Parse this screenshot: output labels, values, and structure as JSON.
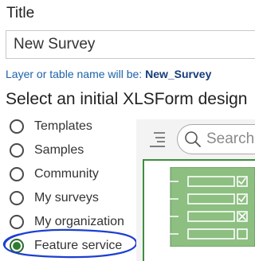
{
  "title_field": {
    "label": "Title",
    "value": "New Survey"
  },
  "layer_hint": {
    "prefix": "Layer or table name will be: ",
    "name": "New_Survey"
  },
  "section_heading": "Select an initial XLSForm design",
  "design_options": [
    {
      "label": "Templates",
      "selected": false
    },
    {
      "label": "Samples",
      "selected": false
    },
    {
      "label": "Community",
      "selected": false
    },
    {
      "label": "My surveys",
      "selected": false
    },
    {
      "label": "My organization",
      "selected": false
    },
    {
      "label": "Feature service",
      "selected": true
    }
  ],
  "search": {
    "placeholder": "Search"
  },
  "colors": {
    "accent_green": "#2e7d32",
    "link_blue": "#1d62a8",
    "annotation_blue": "#1c3fd0",
    "thumbnail_green": "#8cbf80"
  },
  "icons": {
    "sort": "sort-icon",
    "search": "search-icon",
    "thumbnail": "form-template-thumbnail"
  }
}
